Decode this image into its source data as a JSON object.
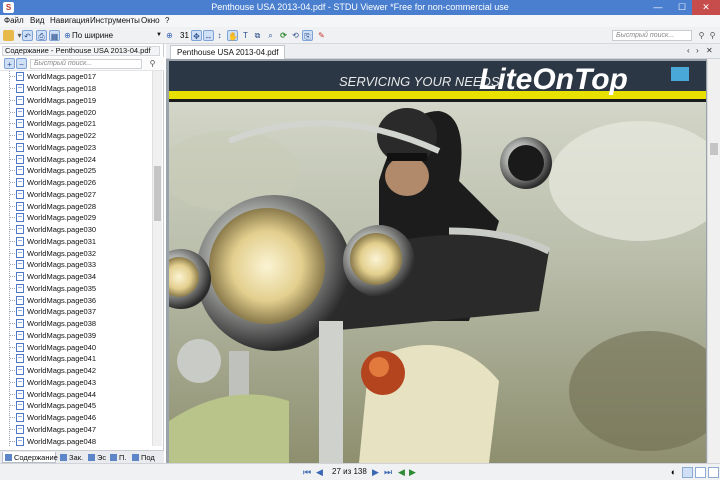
{
  "window": {
    "title": "Penthouse USA 2013-04.pdf - STDU Viewer *Free for non-commercial use",
    "app_icon": "S",
    "minimize": "—",
    "maximize": "☐",
    "close": "✕"
  },
  "menu": [
    "Файл",
    "Вид",
    "Навигация",
    "Инструменты",
    "Окно",
    "?"
  ],
  "toolbar": {
    "zoom_mode": "По ширине",
    "page_number": "31",
    "quick_search_placeholder": "Быстрый поиск..."
  },
  "left_panel": {
    "title": "Содержание - Penthouse USA 2013-04.pdf",
    "search_placeholder": "Быстрый поиск...",
    "items": [
      "WorldMags.page017",
      "WorldMags.page018",
      "WorldMags.page019",
      "WorldMags.page020",
      "WorldMags.page021",
      "WorldMags.page022",
      "WorldMags.page023",
      "WorldMags.page024",
      "WorldMags.page025",
      "WorldMags.page026",
      "WorldMags.page027",
      "WorldMags.page028",
      "WorldMags.page029",
      "WorldMags.page030",
      "WorldMags.page031",
      "WorldMags.page032",
      "WorldMags.page033",
      "WorldMags.page034",
      "WorldMags.page035",
      "WorldMags.page036",
      "WorldMags.page037",
      "WorldMags.page038",
      "WorldMags.page039",
      "WorldMags.page040",
      "WorldMags.page041",
      "WorldMags.page042",
      "WorldMags.page043",
      "WorldMags.page044",
      "WorldMags.page045",
      "WorldMags.page046",
      "WorldMags.page047",
      "WorldMags.page048"
    ],
    "tabs": [
      "Содержание",
      "Зак.",
      "Эс",
      "П.",
      "Под"
    ]
  },
  "document": {
    "tab_label": "Penthouse USA 2013-04.pdf",
    "nav_prev": "‹",
    "nav_next": "›",
    "nav_close": "✕",
    "ad_slogan": "SERVICING YOUR NEEDS",
    "ad_brand": "LiteOnTop"
  },
  "status": {
    "first": "⏮",
    "prev": "◀",
    "page_text": "27 из 138",
    "next": "▶",
    "last": "⏭",
    "back": "◀",
    "forward": "▶"
  },
  "colors": {
    "titlebar": "#4a7fd0",
    "close_button": "#c74d4d",
    "ad_banner": "#2b3744",
    "ad_stripe": "#e8e000"
  }
}
